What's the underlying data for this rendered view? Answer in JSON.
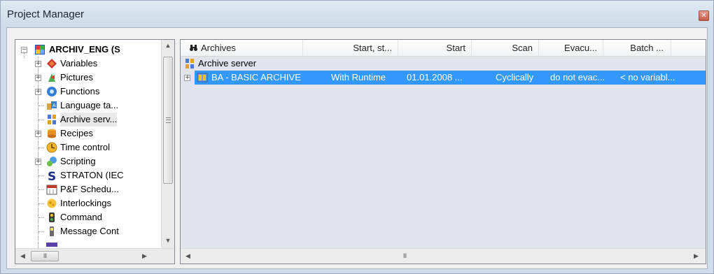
{
  "window": {
    "title": "Project Manager",
    "close_glyph": "✕"
  },
  "tree": {
    "root": {
      "label": "ARCHIV_ENG (S",
      "expander": "−"
    },
    "items": [
      {
        "label": "Variables",
        "icon": "variables-icon",
        "expander": "+"
      },
      {
        "label": "Pictures",
        "icon": "pictures-icon",
        "expander": "+"
      },
      {
        "label": "Functions",
        "icon": "functions-icon",
        "expander": "+"
      },
      {
        "label": "Language ta...",
        "icon": "language-table-icon",
        "expander": ""
      },
      {
        "label": "Archive serv...",
        "icon": "archive-server-icon",
        "expander": ""
      },
      {
        "label": "Recipes",
        "icon": "recipes-icon",
        "expander": "+"
      },
      {
        "label": "Time control",
        "icon": "time-control-icon",
        "expander": ""
      },
      {
        "label": "Scripting",
        "icon": "scripting-icon",
        "expander": "+"
      },
      {
        "label": "STRATON (IEC",
        "icon": "straton-icon",
        "expander": ""
      },
      {
        "label": "P&F Schedu...",
        "icon": "pf-scheduler-icon",
        "expander": ""
      },
      {
        "label": "Interlockings",
        "icon": "interlockings-icon",
        "expander": ""
      },
      {
        "label": "Command",
        "icon": "command-icon",
        "expander": ""
      },
      {
        "label": "Message Cont",
        "icon": "message-control-icon",
        "expander": ""
      }
    ],
    "selected_index": 4
  },
  "list": {
    "columns": [
      "Archives",
      "Start, st...",
      "Start",
      "Scan",
      "Evacu...",
      "Batch ..."
    ],
    "group_label": "Archive server",
    "row": {
      "name": "BA - BASIC ARCHIVE",
      "start_stop": "With Runtime",
      "start": "01.01.2008 ...",
      "scan": "Cyclically",
      "evacuation": "do not evac...",
      "batch": "< no variabl..."
    }
  },
  "scroll": {
    "grip": "III"
  },
  "colors": {
    "selection": "#3399ff",
    "list_background": "#e1e4ed",
    "window_frame": "#cfdceb"
  }
}
